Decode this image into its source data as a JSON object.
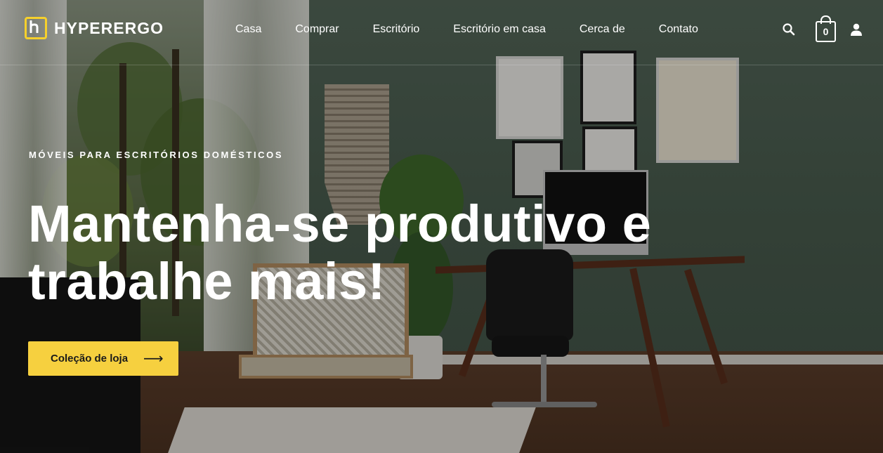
{
  "brand": {
    "name": "HYPERERGO",
    "accent": "#F6D03F"
  },
  "nav": {
    "items": [
      {
        "label": "Casa"
      },
      {
        "label": "Comprar"
      },
      {
        "label": "Escritório"
      },
      {
        "label": "Escritório em casa"
      },
      {
        "label": "Cerca de"
      },
      {
        "label": "Contato"
      }
    ]
  },
  "header_actions": {
    "search_icon": "search-icon",
    "cart_icon": "shopping-bag-icon",
    "cart_count": "0",
    "account_icon": "user-icon"
  },
  "hero": {
    "eyebrow": "MÓVEIS PARA ESCRITÓRIOS DOMÉSTICOS",
    "headline": "Mantenha-se produtivo e trabalhe mais!",
    "cta_label": "Coleção de loja",
    "cta_icon": "arrow-right-icon"
  }
}
